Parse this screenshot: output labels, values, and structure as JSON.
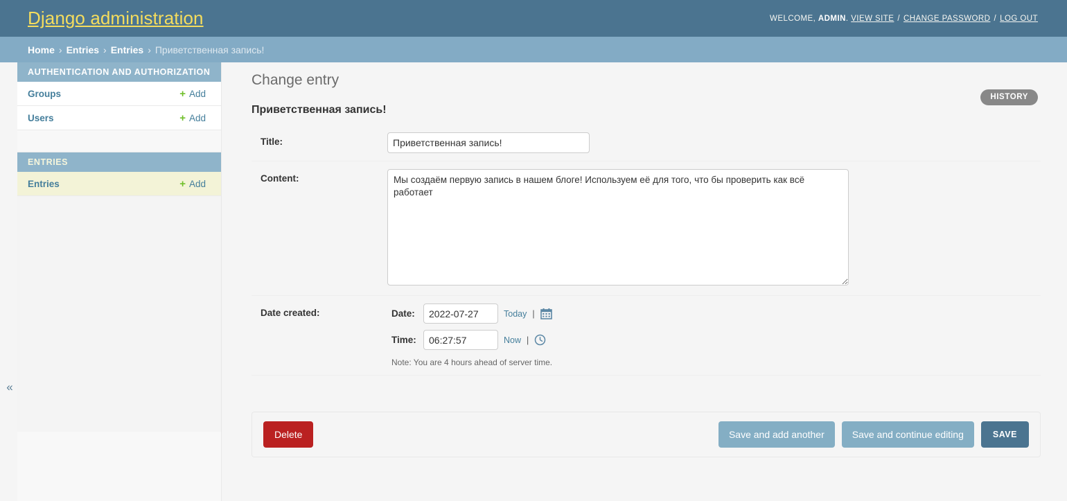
{
  "header": {
    "site_title": "Django administration",
    "welcome_prefix": "WELCOME,",
    "username": "ADMIN",
    "username_suffix": ".",
    "view_site": "VIEW SITE",
    "change_password": "CHANGE PASSWORD",
    "log_out": "LOG OUT",
    "separator": "/"
  },
  "breadcrumbs": {
    "home": "Home",
    "app": "Entries",
    "model": "Entries",
    "current": "Приветственная запись!",
    "chevron": "›"
  },
  "sidebar": {
    "toggle_glyph": "«",
    "add_label": "Add",
    "plus_glyph": "+",
    "apps": [
      {
        "caption": "AUTHENTICATION AND AUTHORIZATION",
        "current": false,
        "models": [
          {
            "name": "Groups",
            "selected": false
          },
          {
            "name": "Users",
            "selected": false
          }
        ]
      },
      {
        "caption": "ENTRIES",
        "current": true,
        "models": [
          {
            "name": "Entries",
            "selected": true
          }
        ]
      }
    ]
  },
  "main": {
    "page_title": "Change entry",
    "history_label": "HISTORY",
    "object_name": "Приветственная запись!",
    "fields": {
      "title": {
        "label": "Title:",
        "value": "Приветственная запись!"
      },
      "content": {
        "label": "Content:",
        "value": "Мы создаём первую запись в нашем блоге! Используем её для того, что бы проверить как всё работает"
      },
      "date_created": {
        "label": "Date created:",
        "date_label": "Date:",
        "date_value": "2022-07-27",
        "date_shortcut": "Today",
        "time_label": "Time:",
        "time_value": "06:27:57",
        "time_shortcut": "Now",
        "pipe": "|",
        "timezone_note": "Note: You are 4 hours ahead of server time."
      }
    },
    "buttons": {
      "delete": "Delete",
      "save_add_another": "Save and add another",
      "save_continue": "Save and continue editing",
      "save": "SAVE"
    }
  },
  "colors": {
    "header_bg": "#4b7490",
    "breadcrumb_bg": "#83abc5",
    "brand_yellow": "#f5dd5d",
    "link_blue": "#447e9b",
    "module_caption_bg": "#8fb4ca",
    "selected_row_bg": "#f3f3d7",
    "add_green": "#70bf2b",
    "delete_red": "#ba2121",
    "button_light": "#84aec4",
    "button_default": "#4b7490",
    "history_gray": "#888888"
  }
}
